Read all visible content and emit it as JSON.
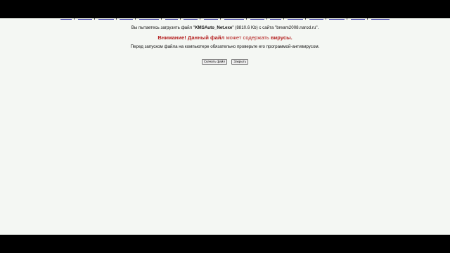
{
  "links": [
    {
      "label": ""
    },
    {
      "label": ""
    },
    {
      "label": ""
    },
    {
      "label": ""
    },
    {
      "label": ""
    },
    {
      "label": ""
    },
    {
      "label": ""
    },
    {
      "label": ""
    },
    {
      "label": ""
    },
    {
      "label": ""
    },
    {
      "label": ""
    },
    {
      "label": ""
    },
    {
      "label": ""
    },
    {
      "label": ""
    },
    {
      "label": ""
    },
    {
      "label": ""
    }
  ],
  "download": {
    "prefix": "Вы пытаетесь загрузить файл \"",
    "filename": "KMSAuto_Net.exe",
    "middle": "\" (8810.6 Kb) с сайта \"bream2008.narod.ru\"."
  },
  "warning": {
    "bold_part": "Внимание! Данный файл",
    "plain_part": " может содержать ",
    "bold_tail": "вирусы."
  },
  "advice": "Перед запуском файла на компьютере обязательно проверьте его программой-антивирусом.",
  "buttons": {
    "download_label": "Скачать файл",
    "close_label": "Закрыть"
  },
  "colors": {
    "page_bg": "#f4f7f3",
    "warning_red": "#b52222",
    "link_blue": "#3a3aa8",
    "letterbox": "#000000"
  }
}
